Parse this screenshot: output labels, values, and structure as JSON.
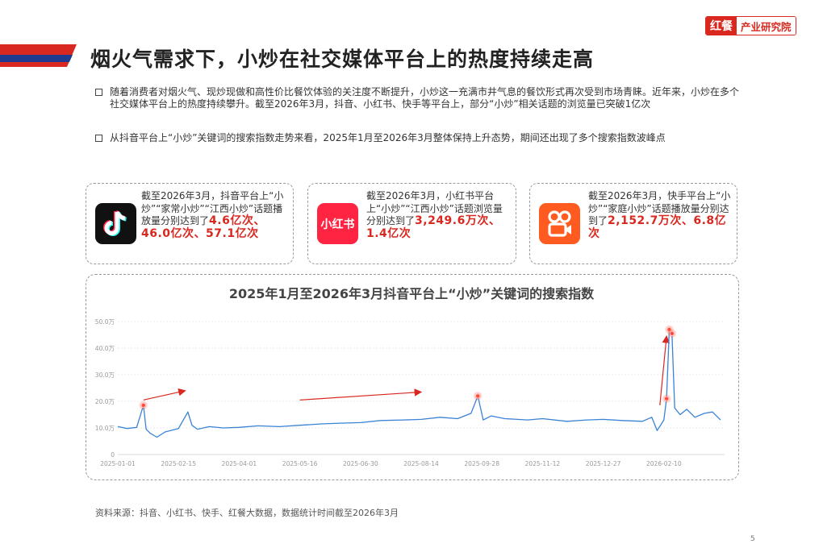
{
  "header": {
    "title": "烟火气需求下，小炒在社交媒体平台上的热度持续走高",
    "logo_main": "红餐",
    "logo_sub": "产业研究院"
  },
  "bullets": [
    "随着消费者对烟火气、现炒现做和高性价比餐饮体验的关注度不断提升，小炒这一充满市井气息的餐饮形式再次受到市场青睐。近年来，小炒在多个社交媒体平台上的热度持续攀升。截至2026年3月，抖音、小红书、快手等平台上，部分“小炒”相关话题的浏览量已突破1亿次",
    "从抖音平台上“小炒”关键词的搜索指数走势来看，2025年1月至2026年3月整体保持上升态势，期间还出现了多个搜索指数波峰点"
  ],
  "cards": [
    {
      "platform": "抖音",
      "icon": "douyin-logo-icon",
      "text": "截至2026年3月，抖音平台上“小炒”“家常小炒”“江西小炒”话题播放量分别达到了",
      "highlight": "4.6亿次、46.0亿次、57.1亿次"
    },
    {
      "platform": "小红书",
      "icon": "xiaohongshu-logo-icon",
      "icon_text": "小红书",
      "text": "截至2026年3月，小红书平台上“小炒”“江西小炒”话题浏览量分别达到了",
      "highlight": "3,249.6万次、1.4亿次"
    },
    {
      "platform": "快手",
      "icon": "kuaishou-logo-icon",
      "text": "截至2026年3月，快手平台上“小炒”“家庭小炒”话题播放量分别达到了",
      "highlight": "2,152.7万次、6.8亿次"
    }
  ],
  "chart_data": {
    "type": "line",
    "title": "2025年1月至2026年3月抖音平台上“小炒”关键词的搜索指数",
    "xlabel": "",
    "ylabel": "",
    "ylim": [
      0,
      50
    ],
    "y_unit": "万",
    "y_ticks": [
      "0",
      "10.0万",
      "20.0万",
      "30.0万",
      "40.0万",
      "50.0万"
    ],
    "x_ticks": [
      "2025-01-01",
      "2025-02-15",
      "2025-04-01",
      "2025-05-16",
      "2025-06-30",
      "2025-08-14",
      "2025-09-28",
      "2025-11-12",
      "2025-12-27",
      "2026-02-10"
    ],
    "grid": true,
    "line_color": "#3a82d6",
    "accent_color": "#d8281f",
    "series": [
      {
        "x": [
          "2025-01-01",
          "2025-01-08",
          "2025-01-15",
          "2025-01-20",
          "2025-01-22",
          "2025-01-25",
          "2025-01-30",
          "2025-02-05",
          "2025-02-15",
          "2025-02-22",
          "2025-02-25",
          "2025-03-01",
          "2025-03-10",
          "2025-03-20",
          "2025-04-01",
          "2025-04-15",
          "2025-05-01",
          "2025-05-16",
          "2025-06-01",
          "2025-06-15",
          "2025-06-30",
          "2025-07-15",
          "2025-08-01",
          "2025-08-14",
          "2025-08-28",
          "2025-09-10",
          "2025-09-20",
          "2025-09-25",
          "2025-09-29",
          "2025-10-05",
          "2025-10-15",
          "2025-11-01",
          "2025-11-12",
          "2025-11-30",
          "2025-12-15",
          "2025-12-27",
          "2026-01-10",
          "2026-01-25",
          "2026-02-01",
          "2026-02-05",
          "2026-02-10",
          "2026-02-12",
          "2026-02-14",
          "2026-02-16",
          "2026-02-18",
          "2026-02-22",
          "2026-02-27",
          "2026-03-05",
          "2026-03-12",
          "2026-03-18",
          "2026-03-24"
        ],
        "values": [
          10.5,
          9.8,
          10.2,
          18.5,
          9.5,
          8.0,
          6.5,
          8.5,
          9.8,
          16.0,
          11.0,
          9.5,
          10.5,
          10.0,
          10.2,
          10.8,
          10.5,
          11.0,
          11.5,
          11.8,
          12.0,
          12.8,
          13.0,
          13.2,
          14.0,
          13.5,
          15.5,
          22.0,
          13.0,
          14.5,
          13.5,
          13.0,
          13.5,
          12.5,
          13.0,
          13.2,
          12.8,
          12.5,
          14.0,
          9.0,
          13.0,
          21.0,
          47.0,
          45.5,
          17.5,
          15.0,
          17.0,
          14.0,
          15.5,
          16.0,
          13.0
        ]
      }
    ],
    "peaks": [
      {
        "x": "2025-01-20",
        "value": 18.5
      },
      {
        "x": "2025-09-25",
        "value": 22.0
      },
      {
        "x": "2026-02-12",
        "value": 21.0
      },
      {
        "x": "2026-02-14",
        "value": 47.0
      },
      {
        "x": "2026-02-16",
        "value": 45.5
      }
    ]
  },
  "source": "资料来源：抖音、小红书、快手、红餐大数据，数据统计时间截至2026年3月",
  "page_number": "5"
}
